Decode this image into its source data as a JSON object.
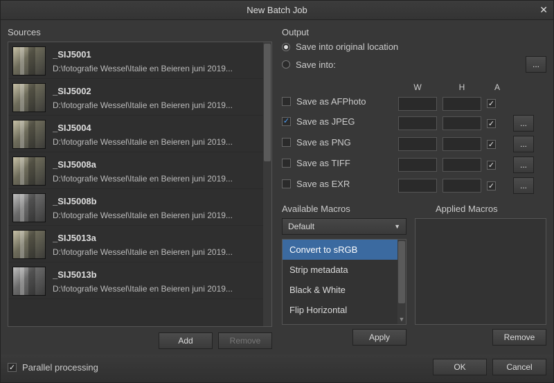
{
  "title": "New Batch Job",
  "sources": {
    "label": "Sources",
    "items": [
      {
        "name": "_SIJ5001",
        "path": "D:\\fotografie Wessel\\Italie en Beieren juni 2019..."
      },
      {
        "name": "_SIJ5002",
        "path": "D:\\fotografie Wessel\\Italie en Beieren juni 2019..."
      },
      {
        "name": "_SIJ5004",
        "path": "D:\\fotografie Wessel\\Italie en Beieren juni 2019..."
      },
      {
        "name": "_SIJ5008a",
        "path": "D:\\fotografie Wessel\\Italie en Beieren juni 2019..."
      },
      {
        "name": "_SIJ5008b",
        "path": "D:\\fotografie Wessel\\Italie en Beieren juni 2019..."
      },
      {
        "name": "_SIJ5013a",
        "path": "D:\\fotografie Wessel\\Italie en Beieren juni 2019..."
      },
      {
        "name": "_SIJ5013b",
        "path": "D:\\fotografie Wessel\\Italie en Beieren juni 2019..."
      }
    ],
    "buttons": {
      "add": "Add",
      "remove": "Remove"
    }
  },
  "output": {
    "label": "Output",
    "save_original": "Save into original location",
    "save_into": "Save into:",
    "save_into_selected": "original",
    "browse": "...",
    "headers": {
      "w": "W",
      "h": "H",
      "a": "A"
    },
    "formats": [
      {
        "label": "Save as AFPhoto",
        "checked": false,
        "a": true,
        "more": false
      },
      {
        "label": "Save as JPEG",
        "checked": true,
        "a": true,
        "more": true
      },
      {
        "label": "Save as PNG",
        "checked": false,
        "a": true,
        "more": true
      },
      {
        "label": "Save as TIFF",
        "checked": false,
        "a": true,
        "more": true
      },
      {
        "label": "Save as EXR",
        "checked": false,
        "a": true,
        "more": true
      }
    ]
  },
  "macros": {
    "available_label": "Available Macros",
    "applied_label": "Applied Macros",
    "set_selected": "Default",
    "items": [
      "Convert to sRGB",
      "Strip metadata",
      "Black & White",
      "Flip Horizontal"
    ],
    "selected_index": 0,
    "apply": "Apply",
    "remove": "Remove"
  },
  "footer": {
    "parallel_checked": true,
    "parallel": "Parallel processing",
    "ok": "OK",
    "cancel": "Cancel"
  }
}
